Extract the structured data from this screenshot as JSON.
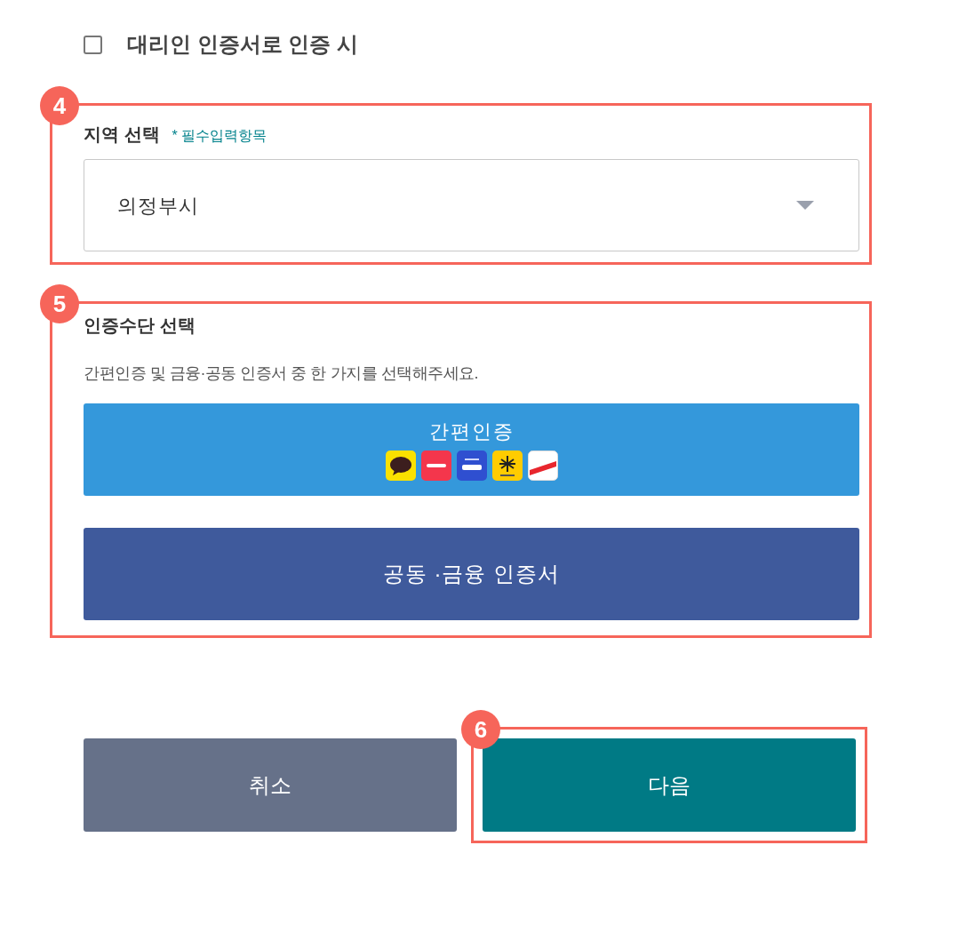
{
  "agent_checkbox": {
    "label": "대리인 인증서로 인증 시",
    "checked": false
  },
  "sections": [
    {
      "kind": "region",
      "callout": "4",
      "title": "지역 선택",
      "required_note": "* 필수입력항목",
      "select": {
        "value": "의정부시"
      }
    },
    {
      "kind": "auth",
      "callout": "5",
      "title": "인증수단 선택",
      "description": "간편인증 및 금융·공동 인증서 중 한 가지를 선택해주세요.",
      "buttons": [
        {
          "kind": "simple",
          "label": "간편인증"
        },
        {
          "kind": "certificate",
          "label": "공동 ·금융 인증서"
        }
      ]
    }
  ],
  "actions": [
    {
      "kind": "cancel",
      "label": "취소"
    },
    {
      "kind": "next",
      "label": "다음",
      "callout": "6"
    }
  ]
}
